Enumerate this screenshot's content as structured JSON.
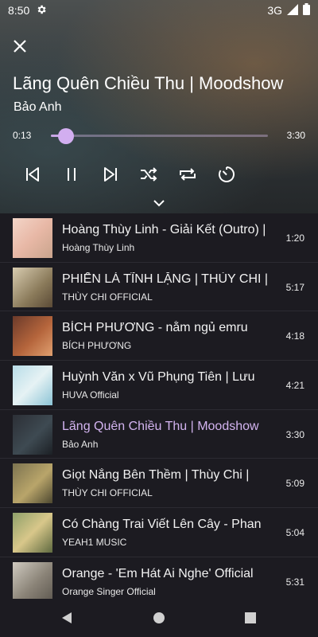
{
  "status": {
    "time": "8:50",
    "network": "3G"
  },
  "now_playing": {
    "title": "Lãng Quên Chiều Thu | Moodshow",
    "artist": "Bảo Anh",
    "current_time": "0:13",
    "total_time": "3:30",
    "progress": 0.068
  },
  "colors": {
    "accent": "#d2aef0",
    "background": "#1c1b21"
  },
  "queue": [
    {
      "title": "Hoàng Thùy Linh - Giải Kết (Outro) |",
      "artist": "Hoàng Thùy Linh",
      "duration": "1:20"
    },
    {
      "title": "PHIẾN LÁ TĨNH LẶNG | THÙY CHI |",
      "artist": "THÙY CHI OFFICIAL",
      "duration": "5:17"
    },
    {
      "title": "BÍCH PHƯƠNG - nằm ngủ emru",
      "artist": "BÍCH PHƯƠNG",
      "duration": "4:18"
    },
    {
      "title": "Huỳnh Văn x Vũ Phụng Tiên | Lưu",
      "artist": "HUVA Official",
      "duration": "4:21"
    },
    {
      "title": "Lãng Quên Chiều Thu | Moodshow",
      "artist": "Bảo Anh",
      "duration": "3:30",
      "active": true
    },
    {
      "title": "Giọt Nắng Bên Thềm | Thùy Chi |",
      "artist": "THÙY CHI OFFICIAL",
      "duration": "5:09"
    },
    {
      "title": "Có Chàng Trai Viết Lên Cây - Phan",
      "artist": "YEAH1 MUSIC",
      "duration": "5:04"
    },
    {
      "title": "Orange - 'Em Hát Ai Nghe' Official",
      "artist": "Orange Singer Official",
      "duration": "5:31"
    }
  ]
}
